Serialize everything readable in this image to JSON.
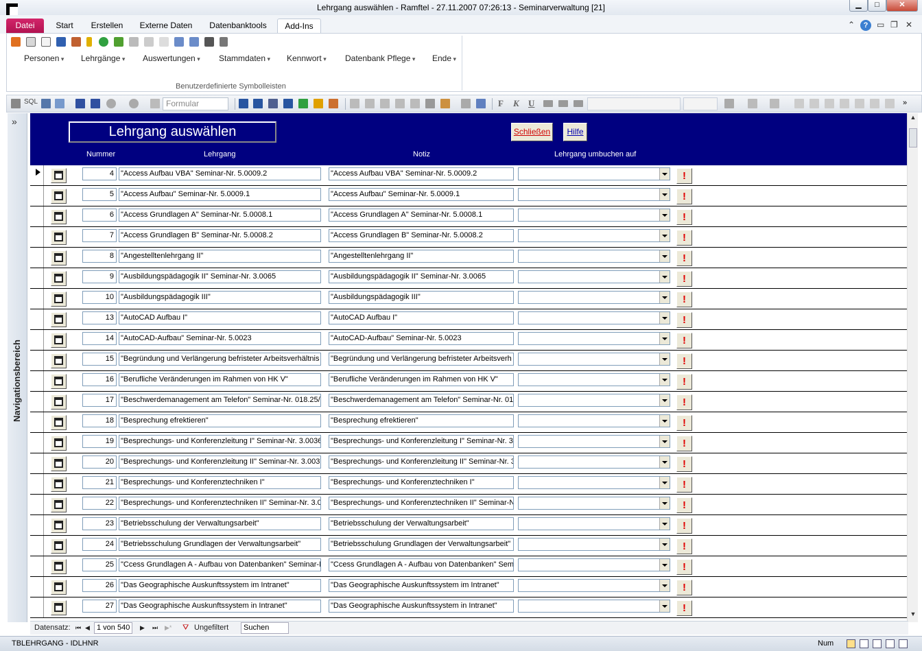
{
  "window": {
    "title": "Lehrgang auswählen - Ramftel - 27.11.2007 07:26:13 - Seminarverwaltung [21]",
    "minimize": "▁",
    "maximize": "□",
    "close": "✕"
  },
  "tabs": {
    "file": "Datei",
    "start": "Start",
    "create": "Erstellen",
    "external": "Externe Daten",
    "dbtools": "Datenbanktools",
    "addins": "Add-Ins"
  },
  "ribbon_right": {
    "help": "?"
  },
  "ribbon": {
    "menus": [
      "Personen",
      "Lehrgänge",
      "Auswertungen",
      "Stammdaten",
      "Kennwort",
      "Datenbank Pflege",
      "Ende"
    ],
    "group_label": "Benutzerdefinierte Symbolleisten"
  },
  "toolbar": {
    "sql": "SQL",
    "form_dropdown": "Formular",
    "font_bold": "F",
    "font_italic": "K",
    "font_underline": "U"
  },
  "nav": {
    "toggle": "»",
    "label": "Navigationsbereich"
  },
  "form": {
    "title": "Lehrgang auswählen",
    "close_button": "Schließen",
    "help_button": "Hilfe",
    "columns": {
      "number": "Nummer",
      "course": "Lehrgang",
      "note": "Notiz",
      "rebook": "Lehrgang umbuchen auf"
    },
    "warn_glyph": "!",
    "rows": [
      {
        "nr": "4",
        "lehrgang": "\"Access Aufbau VBA\" Seminar-Nr. 5.0009.2",
        "notiz": "\"Access Aufbau VBA\" Seminar-Nr. 5.0009.2",
        "current": true
      },
      {
        "nr": "5",
        "lehrgang": "\"Access Aufbau\" Seminar-Nr. 5.0009.1",
        "notiz": "\"Access Aufbau\" Seminar-Nr. 5.0009.1"
      },
      {
        "nr": "6",
        "lehrgang": "\"Access Grundlagen A\" Seminar-Nr. 5.0008.1",
        "notiz": "\"Access Grundlagen A\" Seminar-Nr. 5.0008.1"
      },
      {
        "nr": "7",
        "lehrgang": "\"Access Grundlagen B\" Seminar-Nr. 5.0008.2",
        "notiz": "\"Access Grundlagen B\" Seminar-Nr. 5.0008.2"
      },
      {
        "nr": "8",
        "lehrgang": "\"Angestelltenlehrgang II\"",
        "notiz": "\"Angestelltenlehrgang II\""
      },
      {
        "nr": "9",
        "lehrgang": "\"Ausbildungspädagogik II\" Seminar-Nr. 3.0065",
        "notiz": "\"Ausbildungspädagogik II\" Seminar-Nr. 3.0065"
      },
      {
        "nr": "10",
        "lehrgang": "\"Ausbildungspädagogik III\"",
        "notiz": "\"Ausbildungspädagogik III\""
      },
      {
        "nr": "13",
        "lehrgang": "\"AutoCAD Aufbau I\"",
        "notiz": "\"AutoCAD Aufbau I\""
      },
      {
        "nr": "14",
        "lehrgang": "\"AutoCAD-Aufbau\" Seminar-Nr. 5.0023",
        "notiz": "\"AutoCAD-Aufbau\" Seminar-Nr. 5.0023"
      },
      {
        "nr": "15",
        "lehrgang": "\"Begründung und Verlängerung befristeter Arbeitsverhältnis",
        "notiz": "\"Begründung und Verlängerung befristeter Arbeitsverh"
      },
      {
        "nr": "16",
        "lehrgang": "\"Berufliche Veränderungen im Rahmen von HK V\"",
        "notiz": "\"Berufliche Veränderungen im Rahmen von HK V\""
      },
      {
        "nr": "17",
        "lehrgang": "\"Beschwerdemanagement am Telefon\" Seminar-Nr. 018.25/0",
        "notiz": "\"Beschwerdemanagement am Telefon\" Seminar-Nr. 018"
      },
      {
        "nr": "18",
        "lehrgang": "\"Besprechung efrektieren\"",
        "notiz": "\"Besprechung efrektieren\""
      },
      {
        "nr": "19",
        "lehrgang": "\"Besprechungs- und Konferenzleitung I\" Seminar-Nr. 3.0036",
        "notiz": "\"Besprechungs- und Konferenzleitung I\" Seminar-Nr. 3."
      },
      {
        "nr": "20",
        "lehrgang": "\"Besprechungs- und Konferenzleitung II\" Seminar-Nr. 3.0037",
        "notiz": "\"Besprechungs- und Konferenzleitung II\" Seminar-Nr. 3"
      },
      {
        "nr": "21",
        "lehrgang": "\"Besprechungs- und Konferenztechniken I\"",
        "notiz": "\"Besprechungs- und Konferenztechniken I\""
      },
      {
        "nr": "22",
        "lehrgang": "\"Besprechungs- und Konferenztechniken II\" Seminar-Nr. 3.0",
        "notiz": "\"Besprechungs- und Konferenztechniken II\" Seminar-N"
      },
      {
        "nr": "23",
        "lehrgang": "\"Betriebsschulung der Verwaltungsarbeit\"",
        "notiz": "\"Betriebsschulung der Verwaltungsarbeit\""
      },
      {
        "nr": "24",
        "lehrgang": "\"Betriebsschulung Grundlagen der Verwaltungsarbeit\"",
        "notiz": "\"Betriebsschulung Grundlagen der Verwaltungsarbeit\""
      },
      {
        "nr": "25",
        "lehrgang": "\"Ccess Grundlagen A - Aufbau von Datenbanken\" Seminar-N",
        "notiz": "\"Ccess Grundlagen A - Aufbau von Datenbanken\" Sem"
      },
      {
        "nr": "26",
        "lehrgang": "\"Das Geographische Auskunftssystem im Intranet\"",
        "notiz": "\"Das Geographische Auskunftssystem im Intranet\""
      },
      {
        "nr": "27",
        "lehrgang": "\"Das Geographische Auskunftssystem in Intranet\"",
        "notiz": "\"Das Geographische Auskunftssystem in Intranet\""
      }
    ]
  },
  "recordnav": {
    "label": "Datensatz:",
    "first": "⏮",
    "prev": "◀",
    "position": "1 von 540",
    "next": "▶",
    "last": "⏭",
    "new": "▶*",
    "filter": "Ungefiltert",
    "search": "Suchen"
  },
  "statusbar": {
    "left": "TBLEHRGANG - IDLHNR",
    "num": "Num"
  },
  "scrollbar": {
    "up": "▲",
    "down": "▼"
  },
  "colors": {
    "header_bg": "#000080",
    "file_tab": "#c41a5d",
    "warn": "#e00000"
  }
}
